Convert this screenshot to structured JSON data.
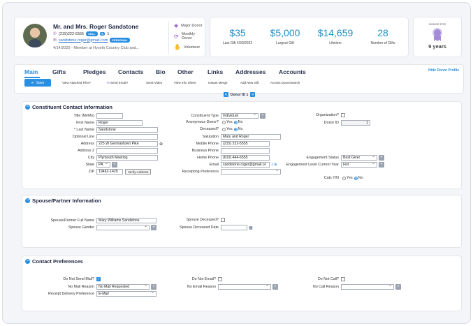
{
  "profile": {
    "name": "Mr. and Mrs. Roger Sandstone",
    "phone": "(215)222-5555",
    "phone_badge": "CELL",
    "count_badge": "m",
    "count": "1",
    "email": "sandstone.roger@gmail.com",
    "email_badge": "PERSONAL",
    "member_line": "4/14/2020 - Member at Hyseth Country Club and..."
  },
  "tags": [
    "Major Donor",
    "Monthly Donor",
    "Volunteer"
  ],
  "stats": [
    {
      "value": "$35",
      "label": "Last Gift 4/30/2022"
    },
    {
      "value": "$5,000",
      "label": "Largest Gift"
    },
    {
      "value": "$14,659",
      "label": "Lifetime"
    },
    {
      "value": "28",
      "label": "Number of Gifts"
    }
  ],
  "donor_for": {
    "title": "DONOR FOR",
    "years": "9 years"
  },
  "tabs": [
    "Main",
    "Gifts",
    "Pledges",
    "Contacts",
    "Bio",
    "Other",
    "Links",
    "Addresses",
    "Accounts"
  ],
  "hide_profile": "Hide Donor Profile",
  "toolbar": {
    "save": "Save",
    "items": [
      "View Attached Files*",
      "Send Email+",
      "Send Video",
      "View Info Sheet",
      "Instant Merge",
      "Add New Gift",
      "Access DonorSearch"
    ]
  },
  "pager": {
    "label": "Donor ID 1",
    "prev": "<",
    "next": ">"
  },
  "constituent": {
    "title": "Constituent Contact Information",
    "fields": {
      "title_label": "Title (Mr/Ms)",
      "title_value": "",
      "first_label": "First Name",
      "first_value": "Roger",
      "last_label": "* Last Name",
      "last_value": "Sandstone",
      "optional_label": "Optional Line",
      "optional_value": "",
      "address_label": "Address",
      "address_value": "225 W Germantown Pike",
      "address2_label": "Address 2",
      "address2_value": "",
      "city_label": "City",
      "city_value": "Plymouth Meeting",
      "state_label": "State",
      "state_value": "PA",
      "zip_label": "ZIP",
      "zip_value": "19462-1429",
      "verify": "Verify Address",
      "ctype_label": "Constituent Type",
      "ctype_value": "Individual",
      "anon_label": "Anonymous Donor?",
      "deceased_label": "Deceased?",
      "yes": "Yes",
      "no": "No",
      "salutation_label": "Salutation",
      "salutation_value": "Mary and Roger",
      "mobile_label": "Mobile Phone",
      "mobile_value": "(215) 222-5555",
      "business_label": "Business Phone",
      "business_value": "",
      "home_label": "Home Phone",
      "home_value": "(610) 444-6555",
      "email_label": "Email",
      "email_value": "sandstone.roger@gmail.co",
      "email_count": "1",
      "receipting_label": "Receipting Preference",
      "receipting_value": "",
      "org_label": "Organization?",
      "donorid_label": "Donor ID",
      "donorid_value": "1",
      "engagement_label": "Engagement Status",
      "engagement_value": "Best Giver",
      "level_label": "Engagement Level Current Year",
      "level_value": "Hot",
      "cats_label": "Cats Y/N"
    }
  },
  "spouse": {
    "title": "Spouse/Partner Information",
    "full_label": "Spouse/Partner Full Name",
    "full_value": "Mary Williams Sandstone",
    "gender_label": "Spouse Gender",
    "gender_value": "",
    "deceased_label": "Spouse Deceased?",
    "date_label": "Spouse Deceased Date",
    "date_value": ""
  },
  "contact_prefs": {
    "title": "Contact Preferences",
    "no_mail_label": "Do Not Send Mail?",
    "no_mail_reason_label": "No Mail Reason",
    "no_mail_reason_value": "No Mail Requested",
    "receipt_label": "Receipt Delivery Preference",
    "receipt_value": "E-Mail",
    "no_email_label": "Do Not Email?",
    "no_email_reason_label": "No Email Reason",
    "no_email_reason_value": "",
    "no_call_label": "Do Not Call?",
    "no_call_reason_label": "No Call Reason",
    "no_call_reason_value": ""
  },
  "colors": {
    "accent": "#2a8fe0",
    "stat": "#1f8fc6",
    "tag_icon": "#8a4fc3"
  }
}
